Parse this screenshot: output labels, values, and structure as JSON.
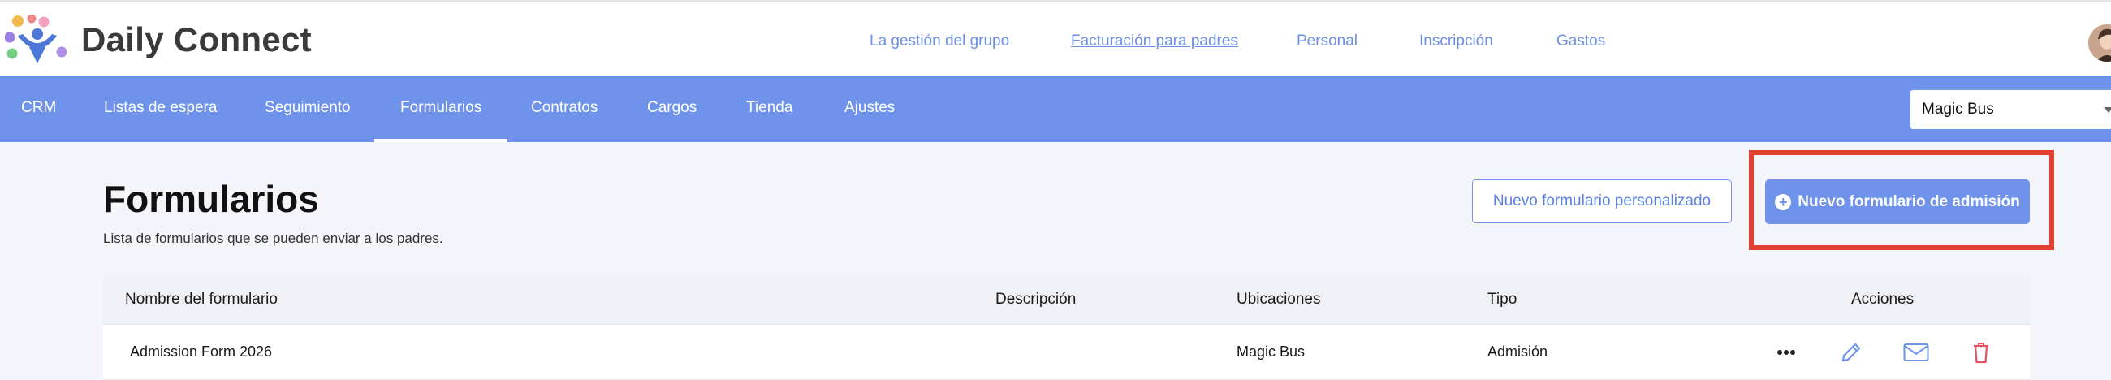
{
  "app": {
    "brand": "Daily Connect",
    "logo_icon": "daily-connect-logo-icon"
  },
  "top_nav": {
    "items": [
      {
        "label": "La gestión del grupo",
        "underlined": false
      },
      {
        "label": "Facturación para padres",
        "underlined": true
      },
      {
        "label": "Personal",
        "underlined": false
      },
      {
        "label": "Inscripción",
        "underlined": false
      },
      {
        "label": "Gastos",
        "underlined": false
      }
    ],
    "avatar_icon": "user-avatar"
  },
  "sub_nav": {
    "items": [
      {
        "label": "CRM",
        "active": false
      },
      {
        "label": "Listas de espera",
        "active": false
      },
      {
        "label": "Seguimiento",
        "active": false
      },
      {
        "label": "Formularios",
        "active": true
      },
      {
        "label": "Contratos",
        "active": false
      },
      {
        "label": "Cargos",
        "active": false
      },
      {
        "label": "Tienda",
        "active": false
      },
      {
        "label": "Ajustes",
        "active": false
      }
    ],
    "location_select": {
      "value": "Magic Bus",
      "icon": "caret-down-icon"
    }
  },
  "page": {
    "title": "Formularios",
    "subtitle": "Lista de formularios que se pueden enviar a los padres.",
    "btn_custom": "Nuevo formulario personalizado",
    "btn_admission": "Nuevo formulario de admisión",
    "btn_admission_icon": "plus-circle-icon"
  },
  "table": {
    "headers": {
      "name": "Nombre del formulario",
      "description": "Descripción",
      "locations": "Ubicaciones",
      "type": "Tipo",
      "actions": "Acciones"
    },
    "rows": [
      {
        "name": "Admission Form 2026",
        "description": "",
        "locations": "Magic Bus",
        "type": "Admisión",
        "actions": [
          "more-icon",
          "edit-pencil-icon",
          "email-icon",
          "trash-icon"
        ]
      }
    ]
  },
  "colors": {
    "accent": "#6f92ea",
    "link": "#6d8ee7",
    "highlight": "#e0402f",
    "danger": "#e05363"
  }
}
